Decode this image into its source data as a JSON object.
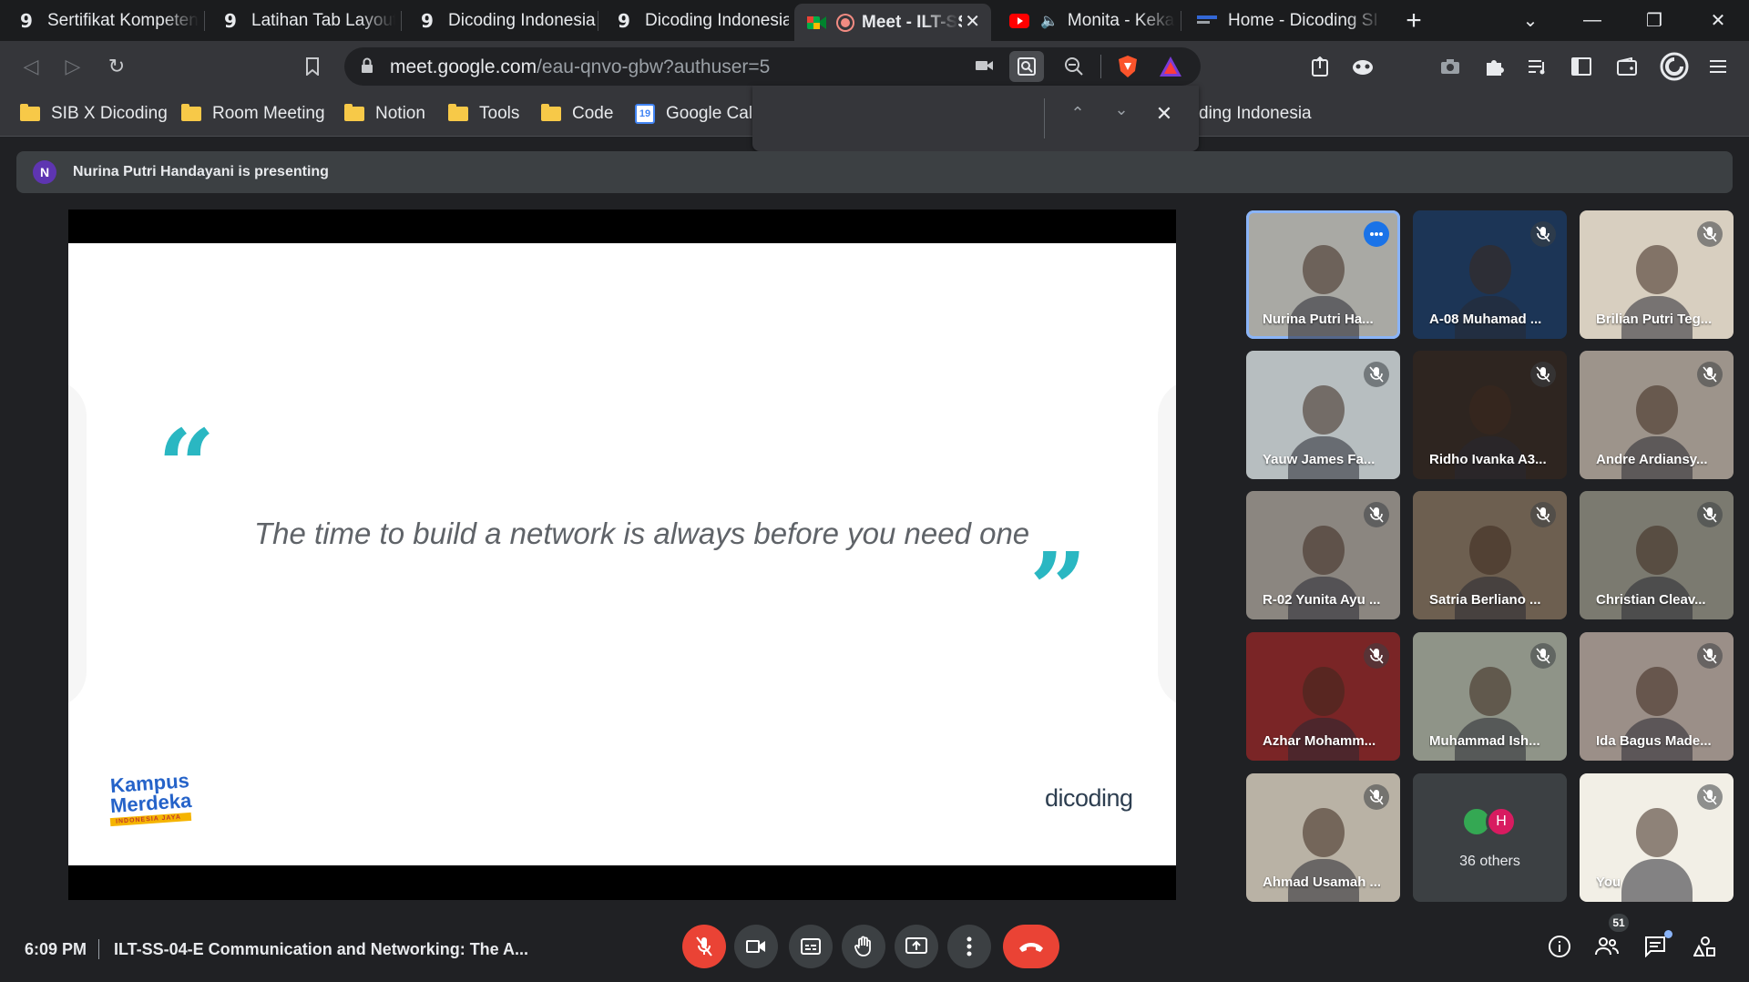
{
  "browser": {
    "tabs": [
      {
        "title": "Sertifikat Kompetens",
        "icon": "dicoding-favicon"
      },
      {
        "title": "Latihan Tab Layout c",
        "icon": "dicoding-favicon"
      },
      {
        "title": "Dicoding Indonesia",
        "icon": "dicoding-favicon"
      },
      {
        "title": "Dicoding Indonesia",
        "icon": "dicoding-favicon"
      },
      {
        "title": "Meet - ILT-SS",
        "icon": "google-meet-favicon",
        "active": true
      },
      {
        "title": "Monita - Kekasih",
        "icon": "youtube-favicon"
      },
      {
        "title": "Home - Dicoding SI",
        "icon": "site-favicon"
      }
    ],
    "url_host": "meet.google.com",
    "url_path": "/eau-qnvo-gbw?authuser=5",
    "bookmarks": [
      {
        "label": "SIB X Dicoding",
        "icon": "folder-icon"
      },
      {
        "label": "Room Meeting",
        "icon": "folder-icon"
      },
      {
        "label": "Notion",
        "icon": "folder-icon"
      },
      {
        "label": "Tools",
        "icon": "folder-icon"
      },
      {
        "label": "Code",
        "icon": "folder-icon"
      },
      {
        "label": "Google Cale",
        "icon": "calendar-icon"
      },
      {
        "label": "ding Indonesia",
        "icon": ""
      }
    ],
    "calendar_day": "19"
  },
  "meet": {
    "presenting_initial": "N",
    "presenting_text": "Nurina Putri Handayani is presenting",
    "slide": {
      "quote": "The time to build a network is always before you need one",
      "logo_left_line1": "Kampus",
      "logo_left_line2": "Merdeka",
      "logo_left_tag": "INDONESIA JAYA",
      "logo_right": "dicoding"
    },
    "participants": [
      {
        "name": "Nurina Putri Ha...",
        "muted": false,
        "bg": "#a9a9a4"
      },
      {
        "name": "A-08 Muhamad ...",
        "muted": true,
        "bg": "#1c3556"
      },
      {
        "name": "Brilian Putri Teg...",
        "muted": true,
        "bg": "#d8cfc0"
      },
      {
        "name": "Yauw James Fa...",
        "muted": true,
        "bg": "#b7bec0"
      },
      {
        "name": "Ridho Ivanka A3...",
        "muted": true,
        "bg": "#2e2520"
      },
      {
        "name": "Andre Ardiansy...",
        "muted": true,
        "bg": "#9d948b"
      },
      {
        "name": "R-02 Yunita Ayu ...",
        "muted": true,
        "bg": "#8b8680"
      },
      {
        "name": "Satria Berliano ...",
        "muted": true,
        "bg": "#6d5f50"
      },
      {
        "name": "Christian Cleav...",
        "muted": true,
        "bg": "#7b7a70"
      },
      {
        "name": "Azhar Mohamm...",
        "muted": true,
        "bg": "#7a2526"
      },
      {
        "name": "Muhammad Ish...",
        "muted": true,
        "bg": "#8f9488"
      },
      {
        "name": "Ida Bagus Made...",
        "muted": true,
        "bg": "#9b8f88"
      },
      {
        "name": "Ahmad Usamah ...",
        "muted": true,
        "bg": "#b9b2a5"
      },
      {
        "name": "36 others",
        "muted": false,
        "bg": "#3c4043",
        "others": true,
        "avatar2_initial": "H"
      },
      {
        "name": "You",
        "muted": true,
        "bg": "#f2efe6"
      }
    ],
    "time": "6:09 PM",
    "meeting_title": "ILT-SS-04-E Communication and Networking: The A...",
    "participant_count": "51",
    "colors": {
      "accent": "#8ab4f8",
      "danger": "#ea4335",
      "quote": "#2ab7c2"
    }
  }
}
